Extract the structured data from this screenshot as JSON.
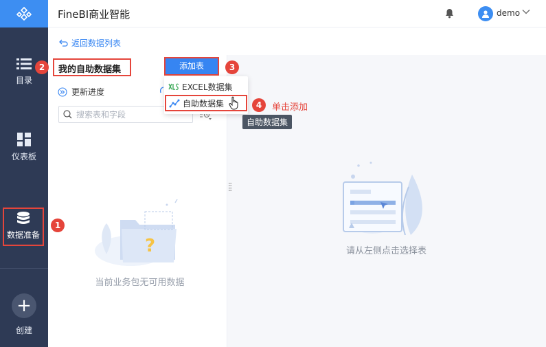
{
  "app": {
    "title": "FineBI商业智能"
  },
  "header": {
    "username": "demo"
  },
  "sidebar": {
    "items": [
      {
        "label": "目录"
      },
      {
        "label": "仪表板"
      },
      {
        "label": "数据准备"
      }
    ],
    "create_label": "创建"
  },
  "nav": {
    "back_label": "返回数据列表"
  },
  "left_panel": {
    "title": "我的自助数据集",
    "update_progress": "更新进度",
    "search_placeholder": "搜索表和字段",
    "empty_text": "当前业务包无可用数据"
  },
  "add_table": {
    "button_label": "添加表",
    "menu": [
      {
        "label": "EXCEL数据集",
        "icon": "excel-icon"
      },
      {
        "label": "自助数据集",
        "icon": "self-dataset-icon"
      }
    ],
    "tooltip": "自助数据集"
  },
  "right_panel": {
    "empty_text": "请从左侧点击选择表"
  },
  "annotations": {
    "badges": [
      "1",
      "2",
      "3",
      "4"
    ],
    "click_note": "单击添加"
  },
  "colors": {
    "accent": "#3685f2",
    "sidebar": "#2e3a55",
    "highlight": "#e5453b"
  }
}
